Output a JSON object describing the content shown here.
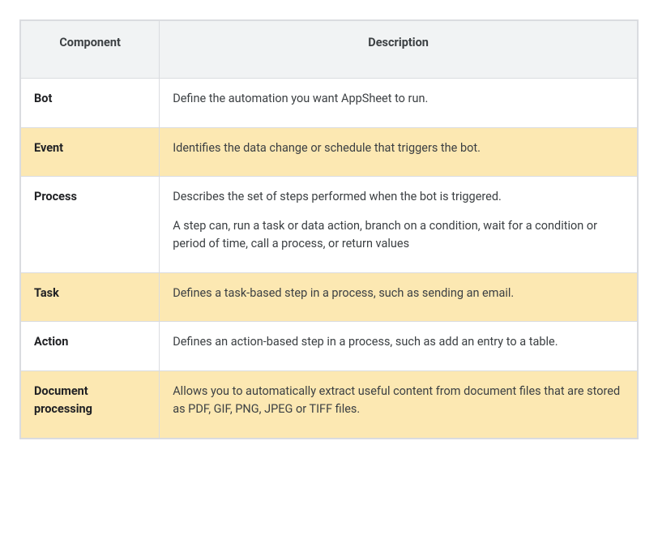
{
  "table": {
    "headers": {
      "component": "Component",
      "description": "Description"
    },
    "rows": [
      {
        "component": "Bot",
        "description": "Define the automation you want AppSheet to run.",
        "highlight": false
      },
      {
        "component": "Event",
        "description": "Identifies the data change or schedule that triggers the bot.",
        "highlight": true
      },
      {
        "component": "Process",
        "description": "Describes the set of steps performed when the bot is triggered.",
        "description2": "A step can, run a task or data action, branch on a condition, wait for a condition or period of time, call a process, or return values",
        "highlight": false
      },
      {
        "component": "Task",
        "description": "Defines a task-based step in a process, such as sending an email.",
        "highlight": true
      },
      {
        "component": "Action",
        "description": "Defines an action-based step in a process, such as add an entry to a table.",
        "highlight": false
      },
      {
        "component": "Document processing",
        "description": "Allows you to automatically extract useful content from document files that are stored as PDF, GIF, PNG, JPEG or TIFF files.",
        "highlight": true
      }
    ]
  }
}
